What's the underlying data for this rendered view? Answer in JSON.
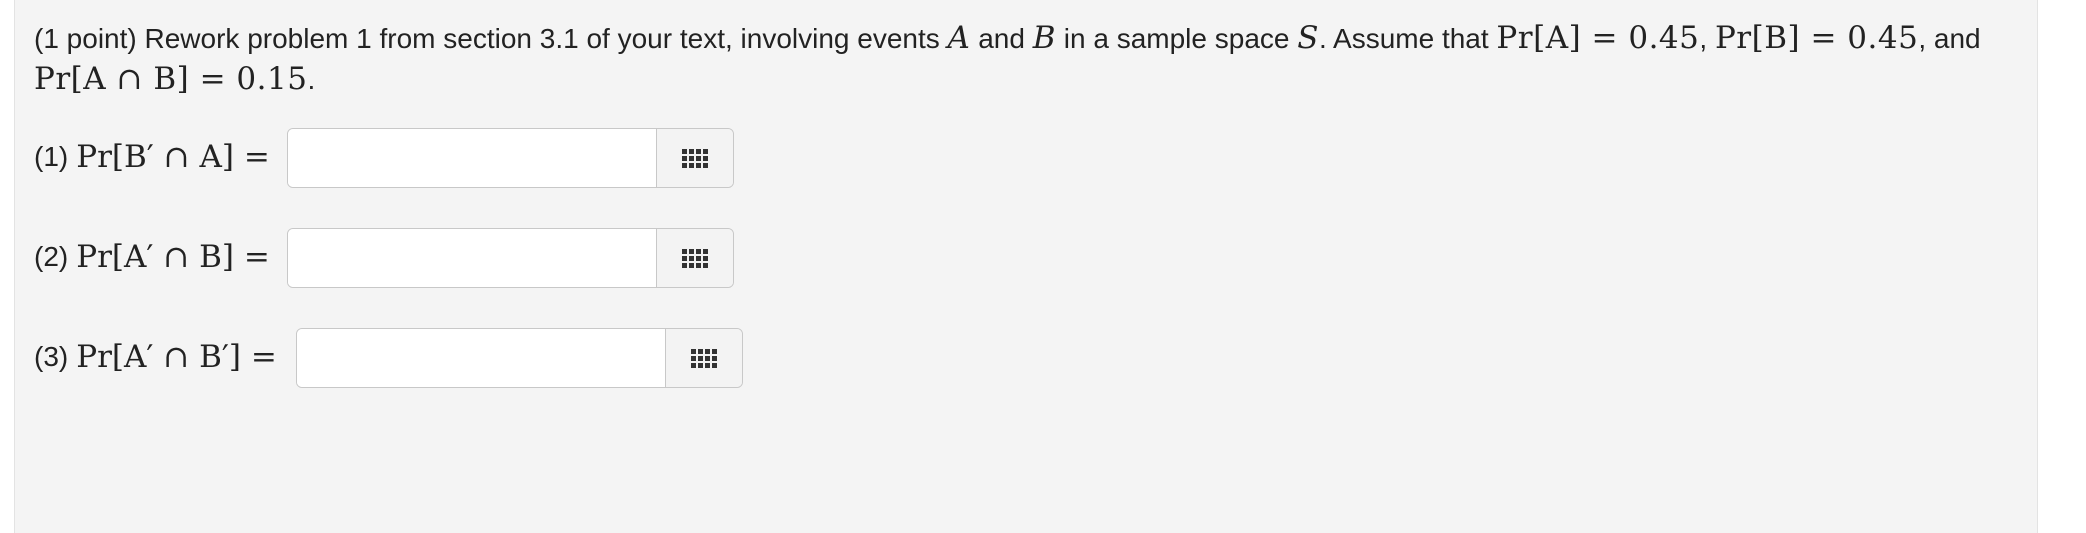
{
  "problem": {
    "points_label": "(1 point)",
    "text_part1": "Rework problem 1 from section 3.1 of your text, involving events",
    "event_a": "A",
    "and_1": "and",
    "event_b": "B",
    "text_part2": "in a sample space",
    "space_s": "S",
    "text_part3": ". Assume that",
    "pr_a_expr": "Pr[A] = 0.45",
    "comma_1": ",",
    "pr_b_expr": "Pr[B] = 0.45",
    "and_2": ", and",
    "pr_ab_expr": "Pr[A ∩ B] = 0.15",
    "period": "."
  },
  "questions": [
    {
      "number": "(1)",
      "expression": "Pr[B′ ∩ A] =",
      "answer_value": "",
      "icon": "equation-editor-grid-icon"
    },
    {
      "number": "(2)",
      "expression": "Pr[A′ ∩ B] =",
      "answer_value": "",
      "icon": "equation-editor-grid-icon"
    },
    {
      "number": "(3)",
      "expression": "Pr[A′ ∩ B′] =",
      "answer_value": "",
      "icon": "equation-editor-grid-icon"
    }
  ],
  "colors": {
    "panel_background": "#f4f4f4",
    "text": "#222222",
    "input_border": "#c8c8c8",
    "button_background": "#f3f3f3"
  }
}
